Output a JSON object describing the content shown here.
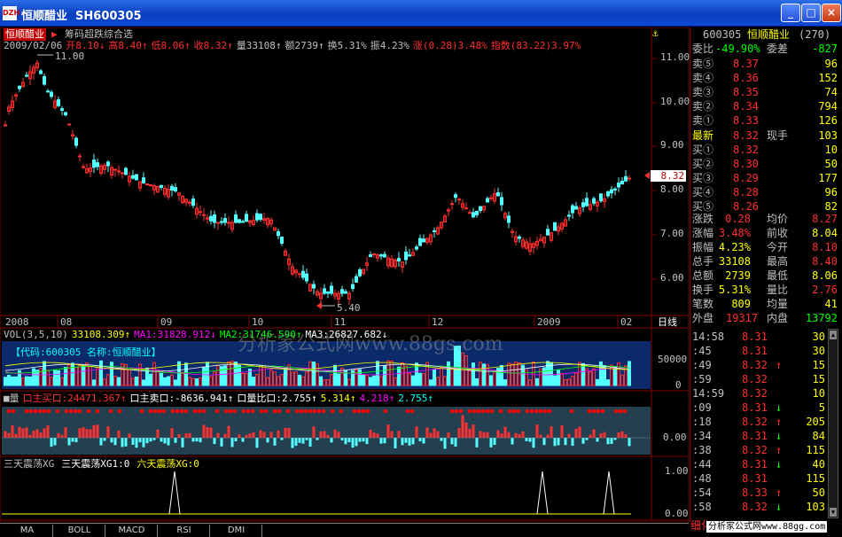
{
  "window": {
    "title": "恒顺醋业  SH600305",
    "icon_label": "DZH",
    "min": "_",
    "max": "□",
    "close": "×"
  },
  "main": {
    "stock_name": "恒顺醋业",
    "indicator_name": "筹码超跌综合选",
    "info_bar": [
      {
        "t": "2009/02/06",
        "c": "#c0c0c0"
      },
      {
        "t": "开8.10↓",
        "c": "#ff3030"
      },
      {
        "t": "高8.40↑",
        "c": "#ff3030"
      },
      {
        "t": "低8.06↑",
        "c": "#ff3030"
      },
      {
        "t": "收8.32↑",
        "c": "#ff3030"
      },
      {
        "t": "量33108↑",
        "c": "#c0c0c0"
      },
      {
        "t": "额2739↑",
        "c": "#c0c0c0"
      },
      {
        "t": "换5.31%",
        "c": "#c0c0c0"
      },
      {
        "t": "振4.23%",
        "c": "#c0c0c0"
      },
      {
        "t": "涨(0.28)3.48%",
        "c": "#ff3030"
      },
      {
        "t": "指数(83.22)3.97%",
        "c": "#ff3030"
      }
    ],
    "price_axis": [
      "11.00",
      "10.00",
      "9.00",
      "8.00",
      "7.00",
      "6.00"
    ],
    "current_price": "8.32",
    "high_marker": "11.00",
    "low_marker": "5.40",
    "date_axis": [
      "2008",
      "08",
      "09",
      "10",
      "11",
      "12",
      "2009",
      "02"
    ],
    "period": "日线"
  },
  "vol": {
    "header": [
      {
        "t": "VOL(3,5,10)",
        "c": "#c0c0c0"
      },
      {
        "t": "33108.309↑",
        "c": "#ffff00"
      },
      {
        "t": "MA1:31828.912↓",
        "c": "#ff00ff"
      },
      {
        "t": "MA2:31746.590↑",
        "c": "#00ff00"
      },
      {
        "t": "MA3:26827.682↓",
        "c": "#ffffff"
      }
    ],
    "overlay_label": "【代码:600305 名称:恒顺醋业】",
    "watermark": "分析家公式网www.88gs.com",
    "axis": [
      "50000",
      "0"
    ]
  },
  "flow": {
    "header": [
      {
        "t": "■量",
        "c": "#c0c0c0"
      },
      {
        "t": "口主买口:24471.367↑",
        "c": "#ff3030"
      },
      {
        "t": "口主卖口:-8636.941↑",
        "c": "#ffffff"
      },
      {
        "t": "口量比口:2.755↑",
        "c": "#ffffff"
      },
      {
        "t": "5.314↑",
        "c": "#ffff00"
      },
      {
        "t": "4.218↑",
        "c": "#ff00ff"
      },
      {
        "t": "2.755↑",
        "c": "#00ffff"
      }
    ],
    "axis": "0.00"
  },
  "osc": {
    "header": [
      {
        "t": "三天震荡XG",
        "c": "#c0c0c0"
      },
      {
        "t": "三天震荡XG1:0",
        "c": "#ffffff"
      },
      {
        "t": "六天震荡XG:0",
        "c": "#ffff00"
      }
    ],
    "axis": [
      "1.00",
      "0.00"
    ]
  },
  "tabs": [
    "MA",
    "BOLL",
    "MACD",
    "RSI",
    "DMI"
  ],
  "quote": {
    "code": "600305",
    "name": "恒顺醋业",
    "num": "(270)",
    "weibi": {
      "l1": "委比",
      "v1": "-49.90%",
      "l2": "委差",
      "v2": "-827"
    },
    "asks": [
      {
        "l": "卖⑤",
        "p": "8.37",
        "v": "96"
      },
      {
        "l": "卖④",
        "p": "8.36",
        "v": "152"
      },
      {
        "l": "卖③",
        "p": "8.35",
        "v": "74"
      },
      {
        "l": "卖②",
        "p": "8.34",
        "v": "794"
      },
      {
        "l": "卖①",
        "p": "8.33",
        "v": "126"
      }
    ],
    "last": {
      "l": "最新",
      "p": "8.32",
      "l2": "现手",
      "v": "103"
    },
    "bids": [
      {
        "l": "买①",
        "p": "8.32",
        "v": "10"
      },
      {
        "l": "买②",
        "p": "8.30",
        "v": "50"
      },
      {
        "l": "买③",
        "p": "8.29",
        "v": "177"
      },
      {
        "l": "买④",
        "p": "8.28",
        "v": "96"
      },
      {
        "l": "买⑤",
        "p": "8.26",
        "v": "82"
      }
    ],
    "stats": [
      {
        "l1": "涨跌",
        "v1": "0.28",
        "l2": "均价",
        "v2": "8.27"
      },
      {
        "l1": "涨幅",
        "v1": "3.48%",
        "l2": "前收",
        "v2": "8.04"
      },
      {
        "l1": "振幅",
        "v1": "4.23%",
        "l2": "今开",
        "v2": "8.10"
      },
      {
        "l1": "总手",
        "v1": "33108",
        "l2": "最高",
        "v2": "8.40"
      },
      {
        "l1": "总额",
        "v1": "2739",
        "l2": "最低",
        "v2": "8.06"
      },
      {
        "l1": "换手",
        "v1": "5.31%",
        "l2": "量比",
        "v2": "2.76"
      },
      {
        "l1": "笔数",
        "v1": "809",
        "l2": "均量",
        "v2": "41"
      }
    ],
    "inout": {
      "l1": "外盘",
      "v1": "19317",
      "l2": "内盘",
      "v2": "13792"
    },
    "ticks": [
      {
        "t": "14:58",
        "p": "8.31",
        "a": "",
        "v": "30"
      },
      {
        "t": ":45",
        "p": "8.31",
        "a": "",
        "v": "30"
      },
      {
        "t": ":49",
        "p": "8.32",
        "a": "↑",
        "v": "15"
      },
      {
        "t": ":59",
        "p": "8.32",
        "a": "",
        "v": "15"
      },
      {
        "t": "14:59",
        "p": "8.32",
        "a": "",
        "v": "10"
      },
      {
        "t": ":09",
        "p": "8.31",
        "a": "↓",
        "v": "5"
      },
      {
        "t": ":18",
        "p": "8.32",
        "a": "↑",
        "v": "205"
      },
      {
        "t": ":34",
        "p": "8.31",
        "a": "↓",
        "v": "84"
      },
      {
        "t": ":38",
        "p": "8.32",
        "a": "↑",
        "v": "115"
      },
      {
        "t": ":44",
        "p": "8.31",
        "a": "↓",
        "v": "40"
      },
      {
        "t": ":48",
        "p": "8.31",
        "a": "",
        "v": "115"
      },
      {
        "t": ":54",
        "p": "8.33",
        "a": "↑",
        "v": "50"
      },
      {
        "t": ":58",
        "p": "8.32",
        "a": "↓",
        "v": "103"
      }
    ],
    "footer_label": "细化",
    "footer_brand": "分析家公式网www.88gg.com"
  }
}
